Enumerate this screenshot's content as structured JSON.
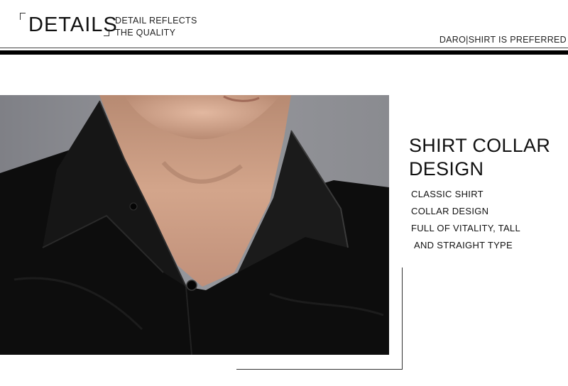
{
  "header": {
    "title": "DETAILS",
    "subtitle_line1": "DETAIL REFLECTS",
    "subtitle_line2": "THE QUALITY",
    "right_text": "DARO|SHIRT IS PREFERRED"
  },
  "feature": {
    "heading_line1": "SHIRT COLLAR",
    "heading_line2": "DESIGN",
    "description": [
      "CLASSIC SHIRT",
      "COLLAR DESIGN",
      "FULL OF VITALITY, TALL",
      "AND STRAIGHT TYPE"
    ]
  },
  "colors": {
    "background": "#ffffff",
    "text": "#111111",
    "photo_backdrop": "#8f9095",
    "shirt": "#0d0d0d",
    "skin": "#c89a80"
  },
  "photo": {
    "subject": "man wearing black shirt with open collar"
  }
}
